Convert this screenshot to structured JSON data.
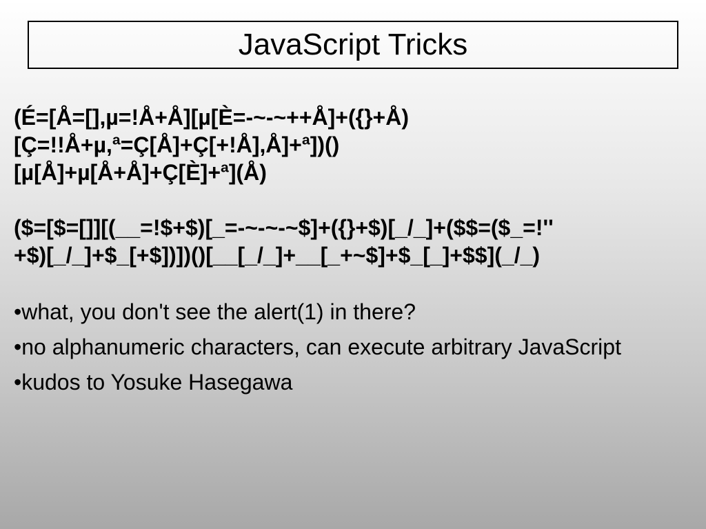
{
  "title": "JavaScript Tricks",
  "code1_line1": "(É=[Å=[],µ=!Å+Å][µ[È=-~-~++Å]+({}+Å)",
  "code1_line2": "[Ç=!!Å+µ,ª=Ç[Å]+Ç[+!Å],Å]+ª])()",
  "code1_line3": "[µ[Å]+µ[Å+Å]+Ç[È]+ª](Å)",
  "code2_line1": "($=[$=[]][(__=!$+$)[_=-~-~-~$]+({}+$)[_/_]+($$=($_=!''",
  "code2_line2": "+$)[_/_]+$_[+$])])()[__[_/_]+__[_+~$]+$_[_]+$$](_/_)",
  "bullets": [
    "•what, you don't see the alert(1) in there?",
    "•no alphanumeric characters, can execute arbitrary JavaScript",
    "•kudos to Yosuke Hasegawa"
  ]
}
